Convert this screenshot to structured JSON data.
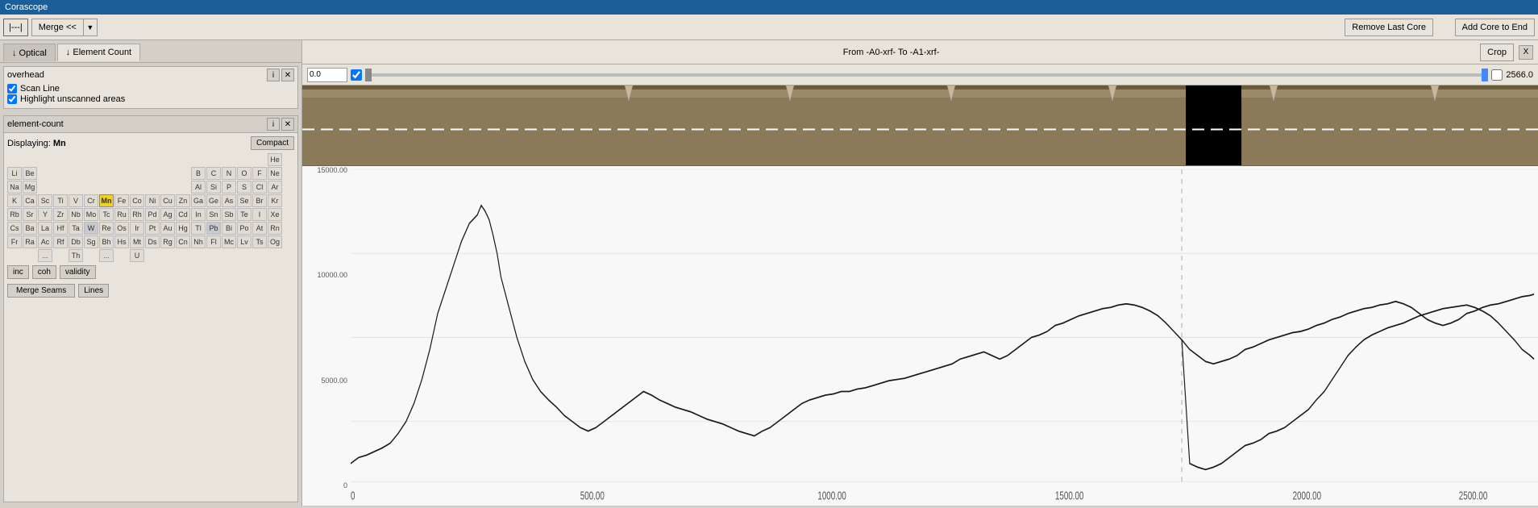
{
  "app": {
    "title": "Corascope"
  },
  "toolbar": {
    "spacer_icon": "|---|",
    "merge_label": "Merge <<",
    "remove_last_core_label": "Remove Last Core",
    "add_core_end_label": "Add Core to End"
  },
  "tabs": [
    {
      "id": "optical",
      "label": "↓ Optical",
      "active": false
    },
    {
      "id": "element-count",
      "label": "↓ Element Count",
      "active": true
    }
  ],
  "overhead_panel": {
    "title": "overhead",
    "scan_line_label": "Scan Line",
    "scan_line_checked": true,
    "highlight_label": "Highlight unscanned areas",
    "highlight_checked": true
  },
  "element_count_panel": {
    "title": "element-count",
    "displaying_label": "Displaying:",
    "displaying_value": "Mn",
    "compact_label": "Compact",
    "filter_buttons": [
      "inc",
      "coh",
      "validity"
    ],
    "merge_seams_label": "Merge Seams",
    "lines_label": "Lines"
  },
  "periodic_table": {
    "rows": [
      [
        "",
        "",
        "",
        "",
        "",
        "",
        "",
        "",
        "",
        "",
        "",
        "",
        "",
        "",
        "",
        "",
        "",
        "He"
      ],
      [
        "Li",
        "Be",
        "",
        "",
        "",
        "",
        "",
        "",
        "",
        "",
        "",
        "",
        "B",
        "C",
        "N",
        "O",
        "F",
        "Ne"
      ],
      [
        "Na",
        "Mg",
        "",
        "",
        "",
        "",
        "",
        "",
        "",
        "",
        "",
        "",
        "Al",
        "Si",
        "P",
        "S",
        "Cl",
        "Ar"
      ],
      [
        "K",
        "Ca",
        "Sc",
        "Ti",
        "V",
        "Cr",
        "Mn",
        "Fe",
        "Co",
        "Ni",
        "Cu",
        "Zn",
        "Ga",
        "Ge",
        "As",
        "Se",
        "Br",
        "Kr"
      ],
      [
        "Rb",
        "Sr",
        "Y",
        "Zr",
        "Nb",
        "Mo",
        "Tc",
        "Ru",
        "Rh",
        "Pd",
        "Ag",
        "Cd",
        "In",
        "Sn",
        "Sb",
        "Te",
        "I",
        "Xe"
      ],
      [
        "Cs",
        "Ba",
        "La",
        "Hf",
        "Ta",
        "W",
        "Re",
        "Os",
        "Ir",
        "Pt",
        "Au",
        "Hg",
        "Tl",
        "Pb",
        "Bi",
        "Po",
        "At",
        "Rn"
      ],
      [
        "Fr",
        "Ra",
        "Ac",
        "Rf",
        "Db",
        "Sg",
        "Bh",
        "Hs",
        "Mt",
        "Ds",
        "Rg",
        "Cn",
        "Nh",
        "Fl",
        "Mc",
        "Lv",
        "Ts",
        "Og"
      ],
      [
        "",
        "",
        "...",
        "",
        "Th",
        "",
        "...",
        "",
        "U",
        "",
        "",
        "",
        "",
        "",
        "",
        "",
        "",
        ""
      ]
    ],
    "selected": "Mn",
    "highlighted": [
      "W",
      "Pb"
    ]
  },
  "viewer": {
    "from_to_label": "From -A0-xrf- To -A1-xrf-",
    "close_label": "X",
    "range_value_left": "0.0",
    "range_value_right": "2566.0",
    "crop_label": "Crop"
  },
  "chart": {
    "y_labels": [
      "15000.00",
      "10000.00",
      "5000.00",
      "0"
    ],
    "x_labels": [
      "0",
      "500.00",
      "1000.00",
      "1500.00",
      "2000.00",
      "2500.00"
    ]
  }
}
